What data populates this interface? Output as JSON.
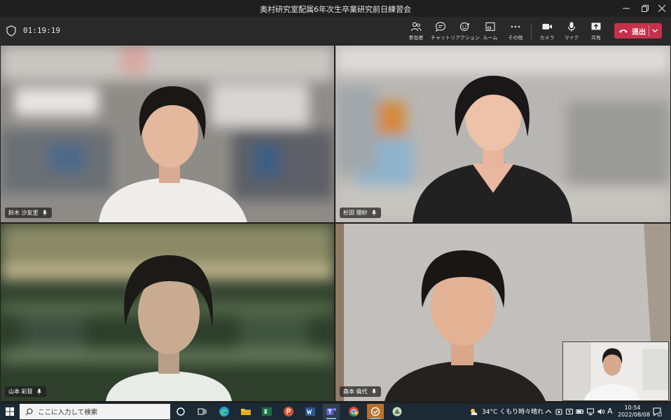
{
  "window": {
    "title": "奥村研究室配属6年次生卒業研究前日練習会"
  },
  "meeting": {
    "elapsed": "01:19:19",
    "toolbar": [
      {
        "label": "参加者",
        "icon": "people-icon"
      },
      {
        "label": "チャット",
        "icon": "chat-icon"
      },
      {
        "label": "リアクション",
        "icon": "reaction-icon"
      },
      {
        "label": "ルーム",
        "icon": "rooms-icon"
      },
      {
        "label": "その他",
        "icon": "more-icon"
      },
      {
        "label": "カメラ",
        "icon": "camera-icon"
      },
      {
        "label": "マイク",
        "icon": "microphone-icon"
      },
      {
        "label": "共有",
        "icon": "share-icon"
      }
    ],
    "leave_label": "退出",
    "participants": [
      {
        "name": "鈴木 沙友里"
      },
      {
        "name": "杉田 理紗"
      },
      {
        "name": "山本 彩賀"
      },
      {
        "name": "森本 倫代"
      }
    ]
  },
  "taskbar": {
    "search_placeholder": "ここに入力して検索",
    "weather": "34°C くもり時々晴れ",
    "ime": "A",
    "time": "10:54",
    "date": "2022/08/08",
    "notification_count": "2"
  },
  "colors": {
    "leave": "#c4314b",
    "toolbar": "#292929",
    "taskbar": "#1b2a35"
  }
}
